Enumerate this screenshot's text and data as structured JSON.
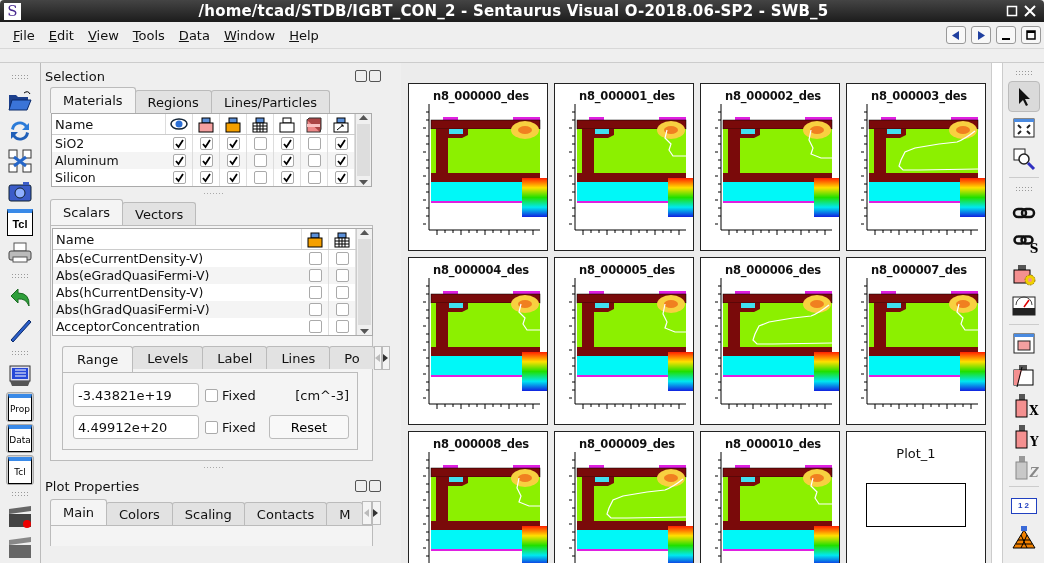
{
  "window": {
    "title": "/home/tcad/STDB/IGBT_CON_2 - Sentaurus Visual O-2018.06-SP2 - SWB_5",
    "app_icon": "S"
  },
  "menu": [
    "File",
    "Edit",
    "View",
    "Tools",
    "Data",
    "Window",
    "Help"
  ],
  "left_toolbar": [
    [
      {
        "kind": "open-folder"
      },
      {
        "kind": "reload"
      },
      {
        "kind": "swap"
      },
      {
        "kind": "camera"
      },
      {
        "kind": "script",
        "label": "Tcl"
      },
      {
        "kind": "printer"
      }
    ],
    [
      {
        "kind": "undo"
      },
      {
        "kind": "pen"
      }
    ],
    [
      {
        "kind": "console"
      },
      {
        "kind": "toggle",
        "label": "Prop",
        "on": true
      },
      {
        "kind": "toggle",
        "label": "Data",
        "on": true
      },
      {
        "kind": "toggle",
        "label": "Tcl",
        "on": true
      }
    ],
    [
      {
        "kind": "movie-record"
      },
      {
        "kind": "movie"
      }
    ]
  ],
  "selection": {
    "title": "Selection",
    "tabs": [
      {
        "label": "Materials",
        "selected": true
      },
      {
        "label": "Regions",
        "selected": false
      },
      {
        "label": "Lines/Particles",
        "selected": false
      }
    ],
    "name_column": "Name",
    "field_name_column": "Name",
    "columns": [
      {
        "kind": "eye"
      },
      {
        "kind": "box-pink"
      },
      {
        "kind": "box-orange"
      },
      {
        "kind": "box-mesh"
      },
      {
        "kind": "box-white"
      },
      {
        "kind": "box-3d"
      },
      {
        "kind": "box-arrow"
      }
    ],
    "rows": [
      {
        "name": "SiO2",
        "checked": [
          true,
          true,
          true,
          false,
          true,
          false,
          true
        ]
      },
      {
        "name": "Aluminum",
        "checked": [
          true,
          true,
          true,
          false,
          true,
          false,
          true
        ]
      },
      {
        "name": "Silicon",
        "checked": [
          true,
          true,
          true,
          false,
          true,
          false,
          true
        ]
      }
    ],
    "field_tabs": [
      {
        "label": "Scalars",
        "selected": true
      },
      {
        "label": "Vectors",
        "selected": false
      }
    ],
    "field_columns": [
      {
        "kind": "box-orange"
      },
      {
        "kind": "box-mesh"
      }
    ],
    "fields": [
      {
        "name": "Abs(eCurrentDensity-V)",
        "checked": [
          false,
          false
        ]
      },
      {
        "name": "Abs(eGradQuasiFermi-V)",
        "checked": [
          false,
          false
        ]
      },
      {
        "name": "Abs(hCurrentDensity-V)",
        "checked": [
          false,
          false
        ]
      },
      {
        "name": "Abs(hGradQuasiFermi-V)",
        "checked": [
          false,
          false
        ]
      },
      {
        "name": "AcceptorConcentration",
        "checked": [
          false,
          false
        ]
      }
    ],
    "range_tabs": [
      {
        "label": "Range",
        "selected": true
      },
      {
        "label": "Levels",
        "selected": false
      },
      {
        "label": "Label",
        "selected": false
      },
      {
        "label": "Lines",
        "selected": false
      },
      {
        "label": "Po",
        "selected": false
      }
    ],
    "range": {
      "min": "-3.43821e+19",
      "min_fixed": false,
      "max": "4.49912e+20",
      "max_fixed": false,
      "min_fixed_label": "Fixed",
      "max_fixed_label": "Fixed",
      "unit": "[cm^-3]",
      "reset": "Reset"
    }
  },
  "plot_properties": {
    "title": "Plot Properties",
    "tabs": [
      {
        "label": "Main",
        "selected": true
      },
      {
        "label": "Colors",
        "selected": false
      },
      {
        "label": "Scaling",
        "selected": false
      },
      {
        "label": "Contacts",
        "selected": false
      },
      {
        "label": "M",
        "selected": false
      }
    ]
  },
  "plots": [
    {
      "title": "n8_000000_des",
      "kind": "device",
      "contour": false
    },
    {
      "title": "n8_000001_des",
      "kind": "device",
      "contour": true
    },
    {
      "title": "n8_000002_des",
      "kind": "device",
      "contour": true
    },
    {
      "title": "n8_000003_des",
      "kind": "device",
      "contour": true
    },
    {
      "title": "n8_000004_des",
      "kind": "device",
      "contour": true
    },
    {
      "title": "n8_000005_des",
      "kind": "device",
      "contour": true
    },
    {
      "title": "n8_000006_des",
      "kind": "device",
      "contour": true
    },
    {
      "title": "n8_000007_des",
      "kind": "device",
      "contour": true
    },
    {
      "title": "n8_000008_des",
      "kind": "device",
      "contour": true
    },
    {
      "title": "n8_000009_des",
      "kind": "device",
      "contour": true
    },
    {
      "title": "n8_000010_des",
      "kind": "device",
      "contour": true
    },
    {
      "title": "Plot_1",
      "kind": "empty"
    }
  ],
  "right_toolbar": [
    [
      {
        "kind": "pointer",
        "selected": true
      },
      {
        "kind": "fit",
        "selected": false
      },
      {
        "kind": "zoom",
        "selected": false
      }
    ],
    [
      {
        "kind": "link"
      },
      {
        "kind": "link-label",
        "label": "S"
      },
      {
        "kind": "gear-box"
      },
      {
        "kind": "gauge"
      }
    ],
    [
      {
        "kind": "window"
      },
      {
        "kind": "cut-box"
      },
      {
        "kind": "axis-box",
        "label": "X",
        "disabled": false
      },
      {
        "kind": "axis-box",
        "label": "Y",
        "disabled": false
      },
      {
        "kind": "axis-box",
        "label": "Z",
        "disabled": true
      }
    ],
    [
      {
        "kind": "ruler",
        "label": "1 2"
      },
      {
        "kind": "grid"
      }
    ]
  ]
}
